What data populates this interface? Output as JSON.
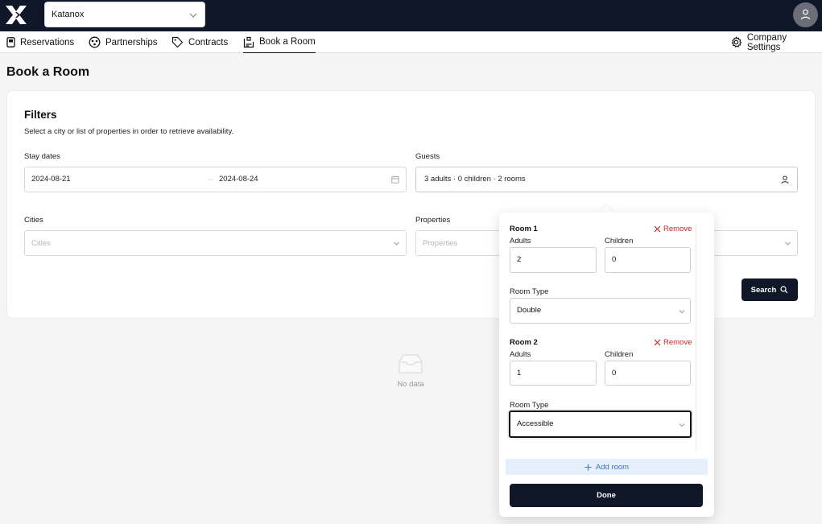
{
  "header": {
    "org_select": {
      "value": "Katanox"
    }
  },
  "nav": {
    "items": [
      {
        "label": "Reservations",
        "icon": "reservations-icon"
      },
      {
        "label": "Partnerships",
        "icon": "partnerships-icon"
      },
      {
        "label": "Contracts",
        "icon": "tag-icon"
      },
      {
        "label": "Book a Room",
        "icon": "book-room-icon",
        "active": true
      }
    ],
    "settings": {
      "label": "Company Settings",
      "icon": "gear-icon"
    }
  },
  "page": {
    "title": "Book a Room"
  },
  "filters": {
    "title": "Filters",
    "subtitle": "Select a city or list of properties in order to retrieve availability.",
    "stay_dates": {
      "label": "Stay dates",
      "start": "2024-08-21",
      "end": "2024-08-24",
      "separator": "→"
    },
    "guests": {
      "label": "Guests",
      "value": "3 adults · 0 children · 2 rooms"
    },
    "cities": {
      "label": "Cities",
      "placeholder": "Cities"
    },
    "properties": {
      "label": "Properties",
      "placeholder": "Properties"
    },
    "search_button": "Search"
  },
  "empty_state": {
    "text": "No data"
  },
  "guests_popover": {
    "rooms": [
      {
        "title": "Room 1",
        "remove_label": "Remove",
        "adults_label": "Adults",
        "adults": "2",
        "children_label": "Children",
        "children": "0",
        "room_type_label": "Room Type",
        "room_type": "Double"
      },
      {
        "title": "Room 2",
        "remove_label": "Remove",
        "adults_label": "Adults",
        "adults": "1",
        "children_label": "Children",
        "children": "0",
        "room_type_label": "Room Type",
        "room_type": "Accessible"
      }
    ],
    "add_room_label": "Add room",
    "done_label": "Done"
  },
  "colors": {
    "navy": "#101729",
    "danger": "#c62828",
    "link": "#3b6fd1",
    "add_room_bg": "#e6f0fc"
  }
}
